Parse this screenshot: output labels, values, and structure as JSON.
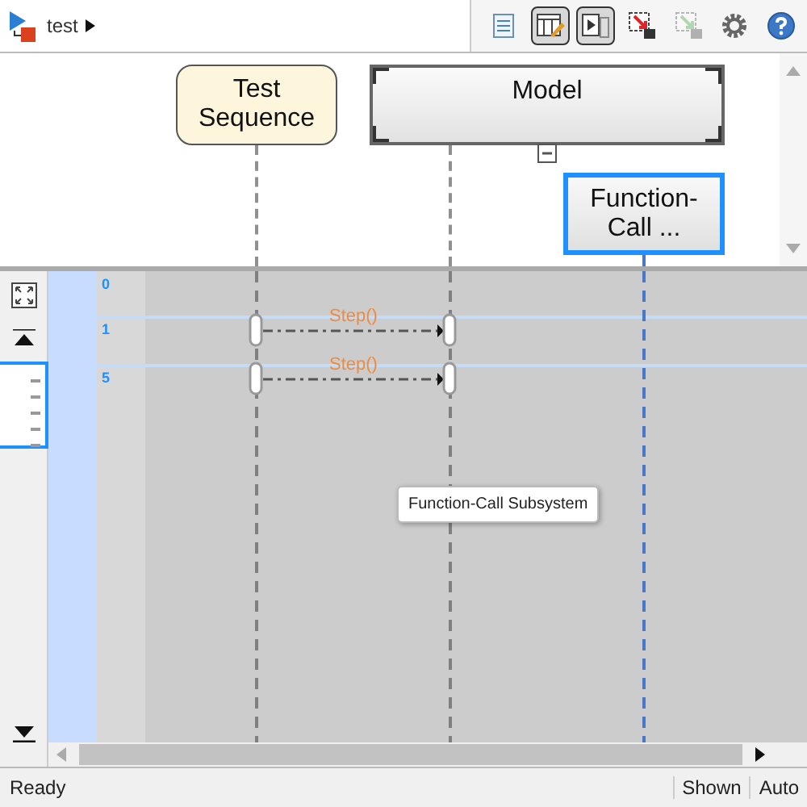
{
  "breadcrumb": {
    "model": "test"
  },
  "toolbar_buttons": [
    {
      "kind": "properties",
      "pressed": false,
      "disabled": false
    },
    {
      "kind": "edit-table",
      "pressed": true,
      "disabled": false
    },
    {
      "kind": "step-view",
      "pressed": true,
      "disabled": false
    },
    {
      "kind": "export",
      "pressed": false,
      "disabled": false
    },
    {
      "kind": "import",
      "pressed": false,
      "disabled": true
    },
    {
      "kind": "settings",
      "pressed": false,
      "disabled": false
    },
    {
      "kind": "help",
      "pressed": false,
      "disabled": false
    }
  ],
  "lifelines": [
    {
      "label": "Test Sequence",
      "kind": "chart",
      "selected": false
    },
    {
      "label": "Model",
      "kind": "model",
      "selected": false,
      "expanded": true
    },
    {
      "label": "Function-Call ...",
      "kind": "subsystem",
      "selected": true
    }
  ],
  "time_rows": [
    {
      "label": "0",
      "messages": []
    },
    {
      "label": "1",
      "messages": [
        {
          "label": "Step()"
        }
      ]
    },
    {
      "label": "5",
      "messages": [
        {
          "label": "Step()"
        }
      ]
    }
  ],
  "tooltip": "Function-Call Subsystem",
  "status_bar": {
    "text": "Ready",
    "cells": [
      "Shown",
      "Auto"
    ]
  }
}
